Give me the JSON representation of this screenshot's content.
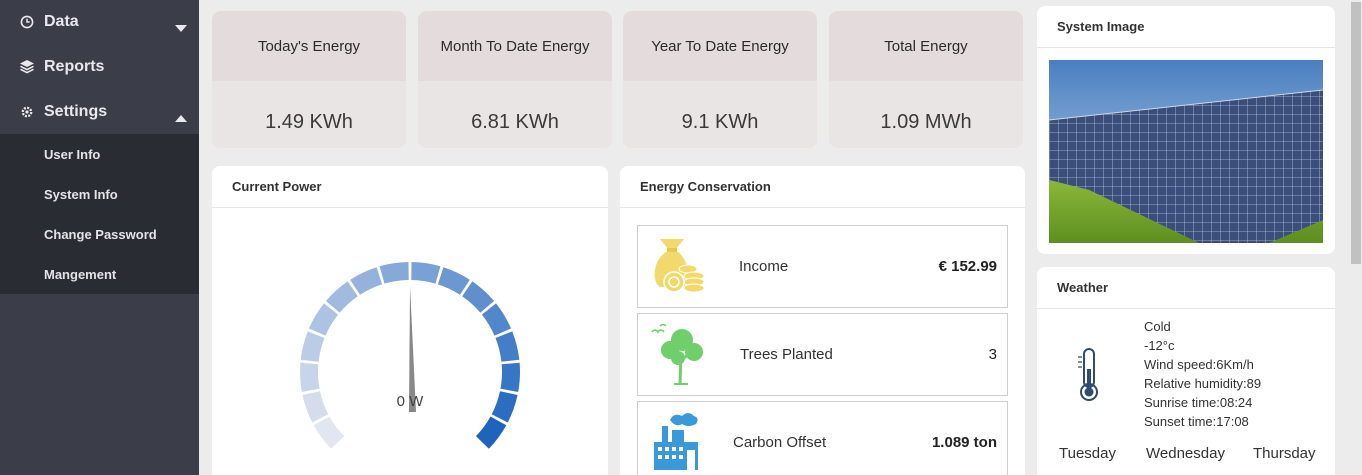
{
  "sidebar": {
    "data_label": "Data",
    "reports_label": "Reports",
    "settings_label": "Settings",
    "sub_items": [
      "User Info",
      "System Info",
      "Change Password",
      "Mangement"
    ]
  },
  "stats": [
    {
      "title": "Today's Energy",
      "value": "1.49 KWh"
    },
    {
      "title": "Month To Date Energy",
      "value": "6.81 KWh"
    },
    {
      "title": "Year To Date Energy",
      "value": "9.1 KWh"
    },
    {
      "title": "Total Energy",
      "value": "1.09 MWh"
    }
  ],
  "current_power": {
    "title": "Current Power",
    "gauge_value": "0 W",
    "needle_level": 0.5
  },
  "energy_conservation": {
    "title": "Energy Conservation",
    "income_label": "Income",
    "income_value": "€ 152.99",
    "trees_label": "Trees Planted",
    "trees_value": "3",
    "carbon_label": "Carbon Offset",
    "carbon_value": "1.089 ton"
  },
  "system_image": {
    "title": "System Image"
  },
  "weather": {
    "title": "Weather",
    "condition": "Cold",
    "temperature": "-12°c",
    "wind": "Wind speed:6Km/h",
    "humidity": "Relative humidity:89",
    "sunrise": "Sunrise time:08:24",
    "sunset": "Sunset time:17:08",
    "days": [
      "Tuesday",
      "Wednesday",
      "Thursday"
    ]
  },
  "colors": {
    "sidebar_bg": "#3b3e48",
    "submenu_bg": "#2a2c33",
    "gauge_dark": "#2a6fc1",
    "icon_yellow": "#f2d96b",
    "icon_green": "#6fcf6b",
    "icon_blue": "#3a9ad9"
  }
}
